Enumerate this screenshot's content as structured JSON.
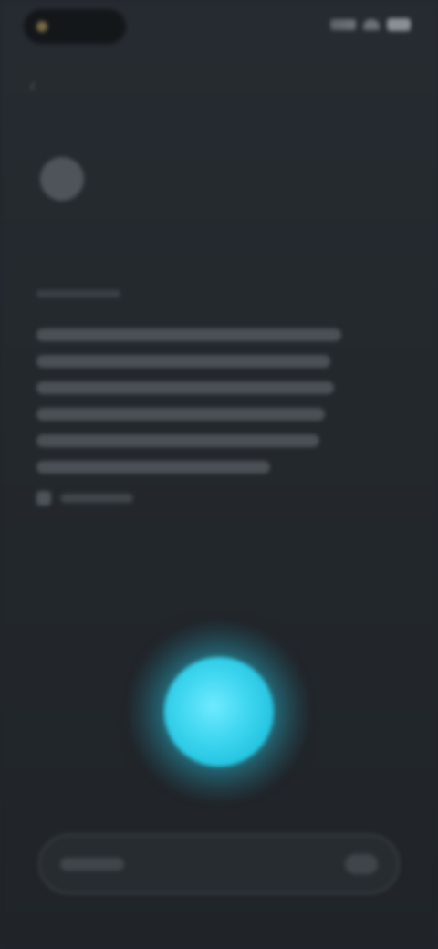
{
  "status_bar": {
    "time": "",
    "icons": [
      "signal-icon",
      "wifi-icon",
      "battery-icon"
    ]
  },
  "header": {
    "back_icon": "back-arrow-icon",
    "title": "",
    "subtitle": ""
  },
  "body": {
    "description": ""
  },
  "orb": {
    "color": "#3fd6f0"
  },
  "bottom_bar": {
    "label": ""
  },
  "colors": {
    "background": "#22272c",
    "accent": "#3fd6f0"
  }
}
